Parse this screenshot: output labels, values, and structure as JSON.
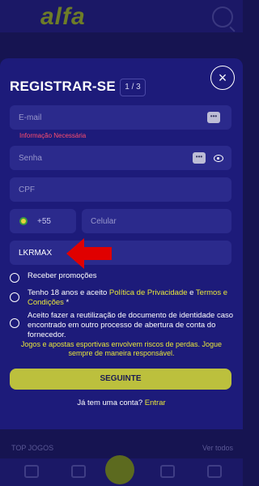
{
  "background": {
    "logo": "alfa",
    "tab_left": "TOP JOGOS",
    "tab_right": "Ver todos"
  },
  "modal": {
    "title": "REGISTRAR-SE",
    "step": "1 / 3",
    "close_icon": "close-icon"
  },
  "form": {
    "email_placeholder": "E-mail",
    "email_error": "Informação Necessária",
    "password_placeholder": "Senha",
    "cpf_placeholder": "CPF",
    "phone_code": "+55",
    "phone_placeholder": "Celular",
    "promo_code_value": "LKRMAX",
    "autofill_icon_text": "•••"
  },
  "checkboxes": {
    "promotions": "Receber promoções",
    "terms_prefix": "Tenho 18 anos e aceito ",
    "privacy_link": "Política de Privacidade",
    "terms_and": " e ",
    "terms_link": "Termos e Condições",
    "terms_suffix": " *",
    "reuse": "Aceito fazer a reutilização de documento de identidade caso encontrado em outro processo de abertura de conta do fornecedor."
  },
  "warning": "Jogos e apostas esportivas envolvem riscos de perdas. Jogue sempre de maneira responsável.",
  "submit_label": "SEGUINTE",
  "login_prompt": "Já tem uma conta? ",
  "login_link": "Entrar",
  "colors": {
    "accent_yellow": "#e8e63a",
    "button": "#bcc03d",
    "error": "#ff4d6d",
    "arrow": "#e00000"
  }
}
